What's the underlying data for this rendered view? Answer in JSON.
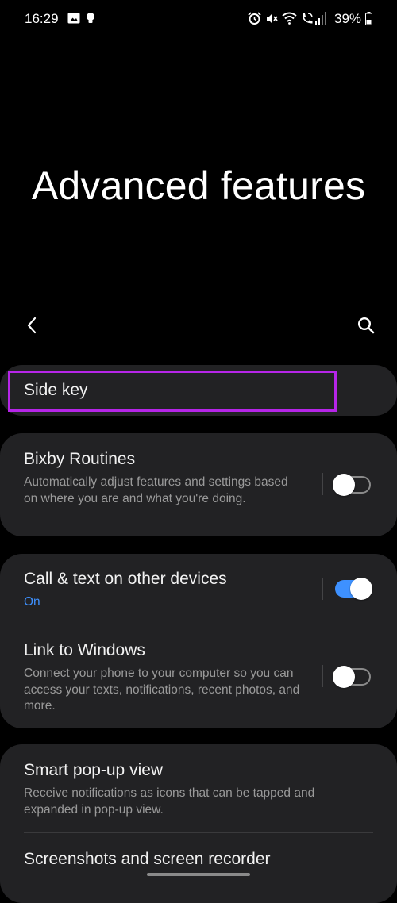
{
  "status_bar": {
    "time": "16:29",
    "battery_percent": "39%",
    "icons": [
      "image-icon",
      "bulb-icon",
      "alarm-icon",
      "mute-icon",
      "wifi-icon",
      "wifi-calling-icon",
      "signal-icon",
      "battery-icon"
    ]
  },
  "header": {
    "title": "Advanced features",
    "back_icon": "back-arrow-icon",
    "search_icon": "search-icon"
  },
  "settings": {
    "side_key": {
      "title": "Side key"
    },
    "bixby_routines": {
      "title": "Bixby Routines",
      "description": "Automatically adjust features and settings based on where you are and what you're doing.",
      "enabled": false
    },
    "call_text": {
      "title": "Call & text on other devices",
      "status": "On",
      "enabled": true
    },
    "link_windows": {
      "title": "Link to Windows",
      "description": "Connect your phone to your computer so you can access your texts, notifications, recent photos, and more.",
      "enabled": false
    },
    "smart_popup": {
      "title": "Smart pop-up view",
      "description": "Receive notifications as icons that can be tapped and expanded in pop-up view."
    },
    "screenshots": {
      "title": "Screenshots and screen recorder"
    }
  },
  "colors": {
    "background": "#000000",
    "card": "#222224",
    "accent": "#3e91ff",
    "highlight": "#b625e8"
  }
}
